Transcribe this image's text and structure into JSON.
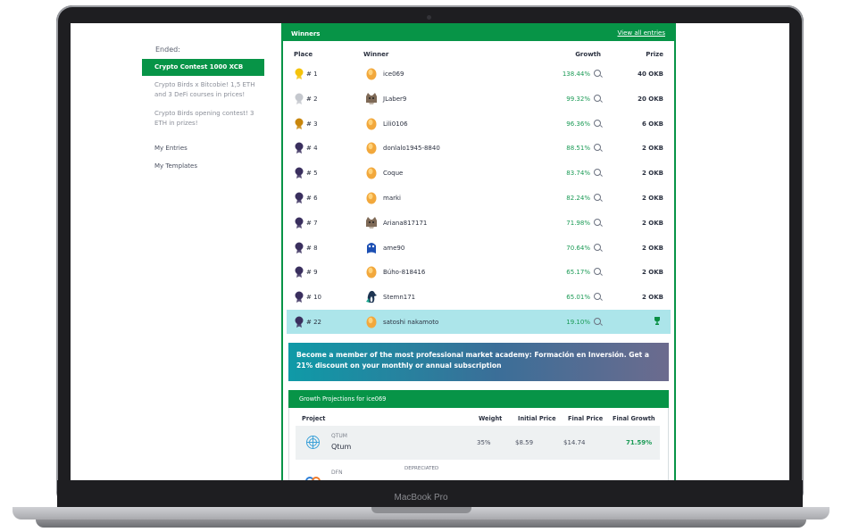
{
  "device": {
    "label": "MacBook Pro"
  },
  "sidebar": {
    "ended_label": "Ended:",
    "active_item": "Crypto Contest 1000 XCB",
    "items": [
      {
        "label": "Crypto Birds x Bitcobie! 1,5 ETH and 3 DeFi courses in prices!"
      },
      {
        "label": "Crypto Birds opening contest! 3 ETH in prizes!"
      }
    ],
    "links": [
      "My Entries",
      "My Templates"
    ]
  },
  "winners": {
    "title": "Winners",
    "view_all": "View all entries",
    "columns": {
      "place": "Place",
      "winner": "Winner",
      "growth": "Growth",
      "prize": "Prize"
    },
    "rows": [
      {
        "place": "# 1",
        "name": "ice069",
        "growth": "138.44%",
        "prize": "40 OKB",
        "medal": "gold",
        "avatar": "egg"
      },
      {
        "place": "# 2",
        "name": "JLaber9",
        "growth": "99.32%",
        "prize": "20 OKB",
        "medal": "silver",
        "avatar": "cat"
      },
      {
        "place": "# 3",
        "name": "Lili0106",
        "growth": "96.36%",
        "prize": "6 OKB",
        "medal": "bronze",
        "avatar": "egg"
      },
      {
        "place": "# 4",
        "name": "donlalo1945-8840",
        "growth": "88.51%",
        "prize": "2 OKB",
        "medal": "dark",
        "avatar": "egg"
      },
      {
        "place": "# 5",
        "name": "Coque",
        "growth": "83.74%",
        "prize": "2 OKB",
        "medal": "dark",
        "avatar": "egg"
      },
      {
        "place": "# 6",
        "name": "marki",
        "growth": "82.24%",
        "prize": "2 OKB",
        "medal": "dark",
        "avatar": "egg"
      },
      {
        "place": "# 7",
        "name": "Ariana817171",
        "growth": "71.98%",
        "prize": "2 OKB",
        "medal": "dark",
        "avatar": "cat"
      },
      {
        "place": "# 8",
        "name": "ame90",
        "growth": "70.64%",
        "prize": "2 OKB",
        "medal": "dark",
        "avatar": "bluebird"
      },
      {
        "place": "# 9",
        "name": "Búho-818416",
        "growth": "65.17%",
        "prize": "2 OKB",
        "medal": "dark",
        "avatar": "egg"
      },
      {
        "place": "# 10",
        "name": "Stemn171",
        "growth": "65.01%",
        "prize": "2 OKB",
        "medal": "dark",
        "avatar": "penguin"
      },
      {
        "place": "# 22",
        "name": "satoshi nakamoto",
        "growth": "19.10%",
        "prize": "",
        "medal": "dark",
        "avatar": "egg",
        "highlight": true
      }
    ]
  },
  "promo": {
    "text": "Become a member of the most professional market academy: Formación en Inversión. Get a 21% discount on your monthly or annual subscription"
  },
  "projections": {
    "title": "Growth Projections for ice069",
    "columns": {
      "project": "Project",
      "weight": "Weight",
      "initial": "Initial Price",
      "final": "Final Price",
      "growth": "Final Growth"
    },
    "rows": [
      {
        "symbol": "QTUM",
        "name": "Qtum",
        "note": "",
        "weight": "35%",
        "initial": "$8.59",
        "final": "$14.74",
        "growth": "71.59%"
      },
      {
        "symbol": "DFN",
        "name": "",
        "note": "DEPRECIATED",
        "weight": "",
        "initial": "",
        "final": "",
        "growth": ""
      }
    ]
  },
  "colors": {
    "brand": "#079447",
    "growth": "#1a9a55",
    "highlight": "#ace5ea"
  }
}
